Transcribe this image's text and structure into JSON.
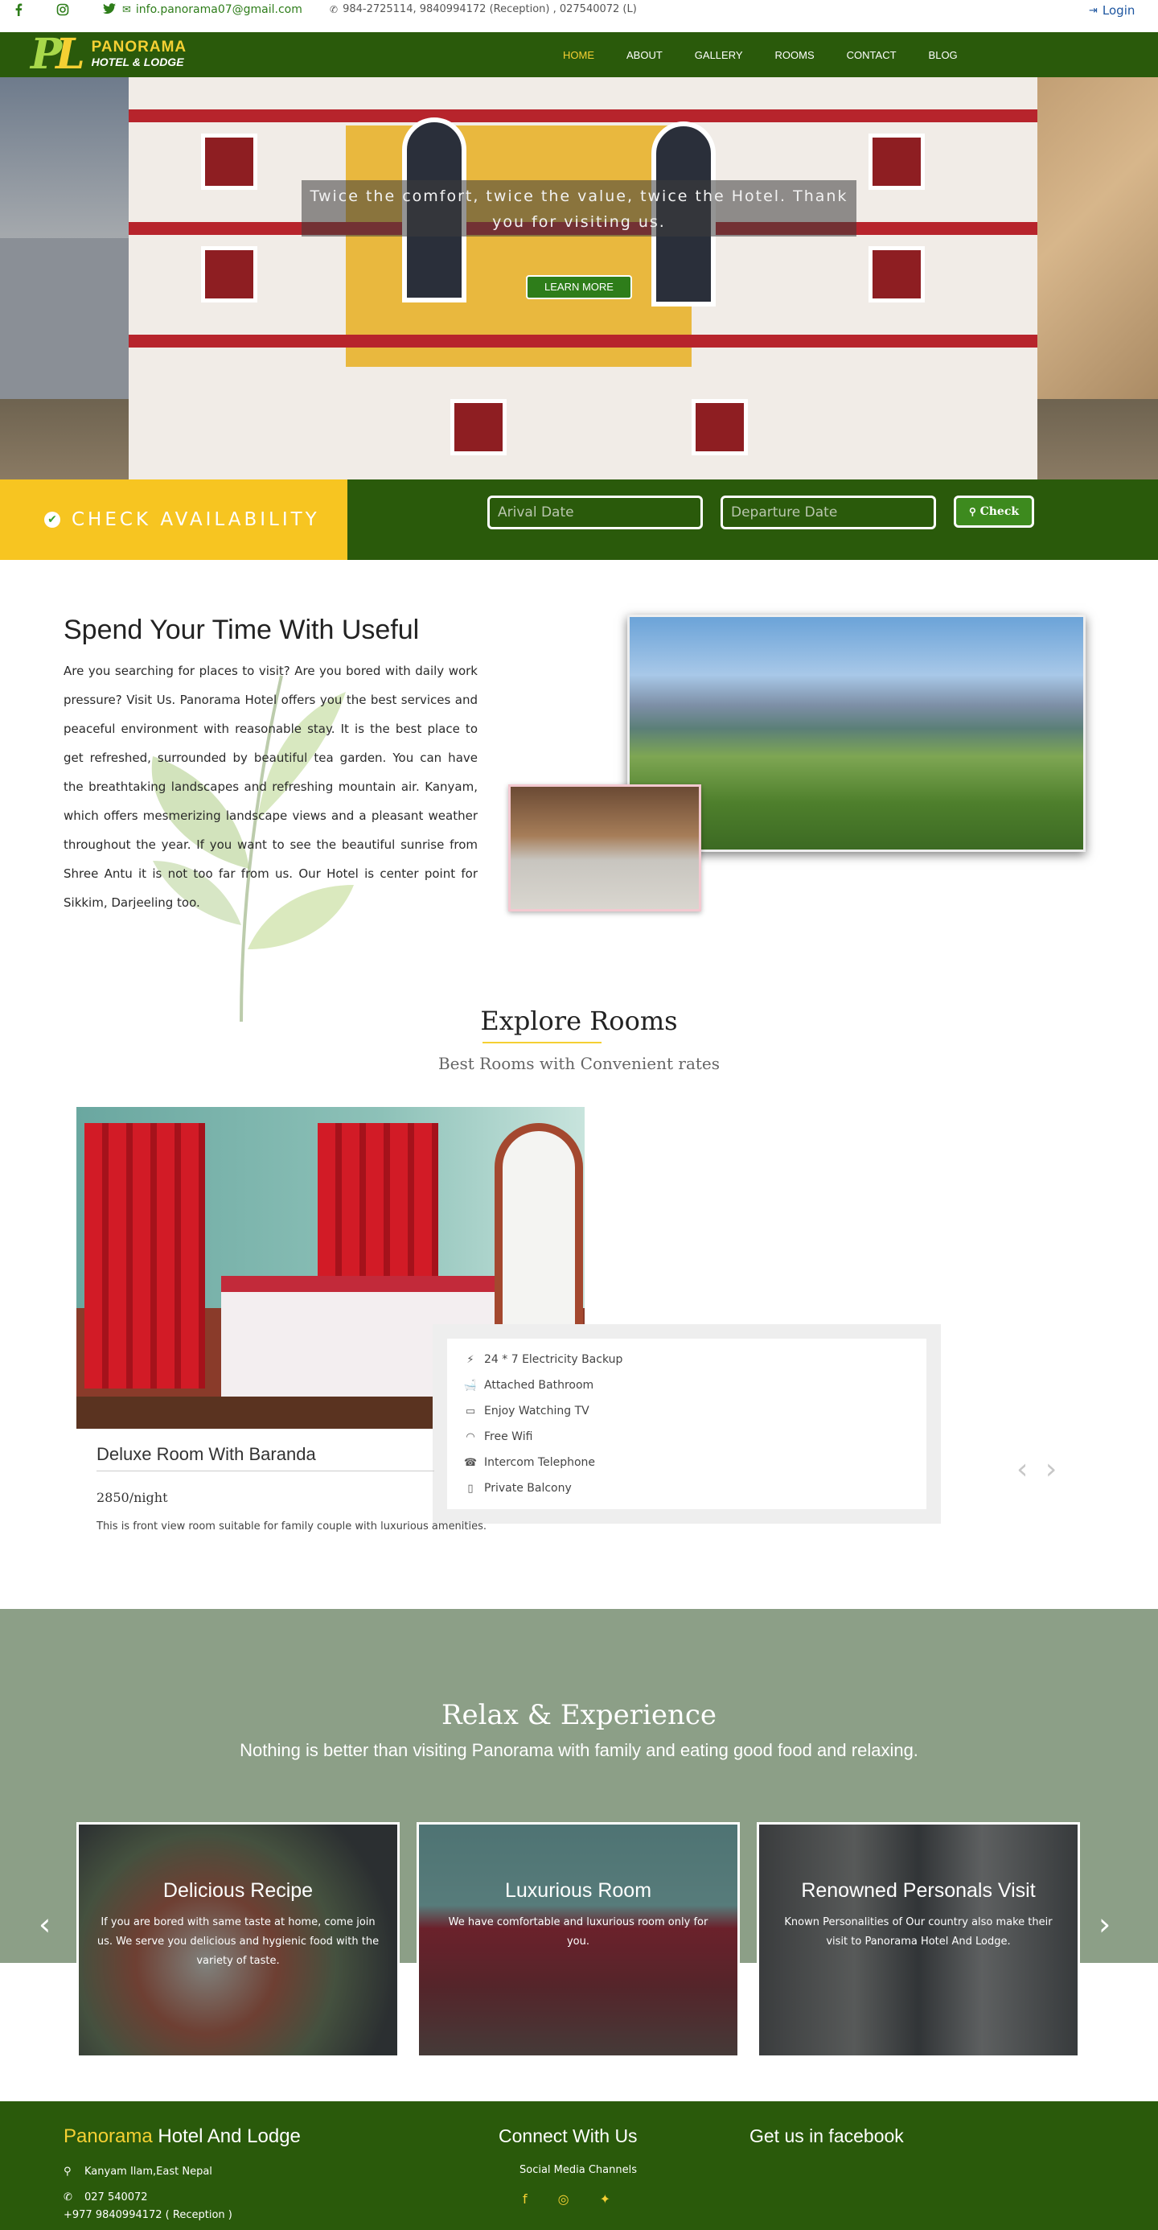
{
  "topbar": {
    "email": "info.panorama07@gmail.com",
    "phones": "984-2725114, 9840994172 (Reception) , 027540072 (L)",
    "login": "Login"
  },
  "nav": {
    "logo_line1": "PANORAMA",
    "logo_line2": "HOTEL & LODGE",
    "items": [
      "HOME",
      "ABOUT",
      "GALLERY",
      "ROOMS",
      "CONTACT",
      "BLOG"
    ],
    "active": "HOME"
  },
  "hero": {
    "caption": "Twice the comfort, twice the value, twice the Hotel. Thank you for visiting us.",
    "button": "LEARN MORE"
  },
  "availability": {
    "title": "CHECK AVAILABILITY",
    "arrival_placeholder": "Arival Date",
    "departure_placeholder": "Departure Date",
    "button": "Check"
  },
  "about": {
    "title": "Spend Your Time With Useful",
    "text": "Are you searching for places to visit? Are you bored with daily work pressure? Visit Us. Panorama Hotel offers you the best services and peaceful environment with reasonable stay. It is the best place to get refreshed, surrounded by beautiful tea garden. You can have the breathtaking landscapes and refreshing mountain air. Kanyam, which offers mesmerizing landscape views and a pleasant weather throughout the year. If you want to see the beautiful sunrise from Shree Antu it is not too far from us. Our Hotel is center point for Sikkim, Darjeeling too."
  },
  "rooms": {
    "title": "Explore Rooms",
    "subtitle": "Best Rooms with Convenient rates",
    "room": {
      "name": "Deluxe Room With Baranda",
      "price": "2850/night",
      "description": "This is front view room suitable for family couple with luxurious amenities.",
      "amenities": [
        {
          "icon": "plug-icon",
          "label": "24 * 7 Electricity Backup"
        },
        {
          "icon": "bath-icon",
          "label": "Attached Bathroom"
        },
        {
          "icon": "tv-icon",
          "label": "Enjoy Watching TV"
        },
        {
          "icon": "wifi-icon",
          "label": "Free Wifi"
        },
        {
          "icon": "phone-icon",
          "label": "Intercom Telephone"
        },
        {
          "icon": "building-icon",
          "label": "Private Balcony"
        }
      ]
    }
  },
  "relax": {
    "title": "Relax & Experience",
    "subtitle": "Nothing is better than visiting Panorama with family and eating good food and relaxing.",
    "cards": [
      {
        "title": "Delicious Recipe",
        "text": "If you are bored with same taste at home, come join us. We serve you delicious and hygienic food with the variety of taste."
      },
      {
        "title": "Luxurious Room",
        "text": "We have comfortable and luxurious room only for you."
      },
      {
        "title": "Renowned Personals Visit",
        "text": "Known Personalities of Our country also make their visit to Panorama Hotel And Lodge."
      }
    ]
  },
  "footer": {
    "brand_highlight": "Panorama",
    "brand_rest": "Hotel And Lodge",
    "address": "Kanyam Ilam,East Nepal",
    "phone1": "027 540072",
    "phone2": "+977 9840994172 ( Reception )",
    "connect_title": "Connect With Us",
    "social_label": "Social Media Channels",
    "facebook_title": "Get us in facebook"
  },
  "colors": {
    "brand_green": "#2a5a0b",
    "accent_yellow": "#f5d033",
    "button_green": "#2e7d1a",
    "relax_bg": "#8c9f87"
  }
}
